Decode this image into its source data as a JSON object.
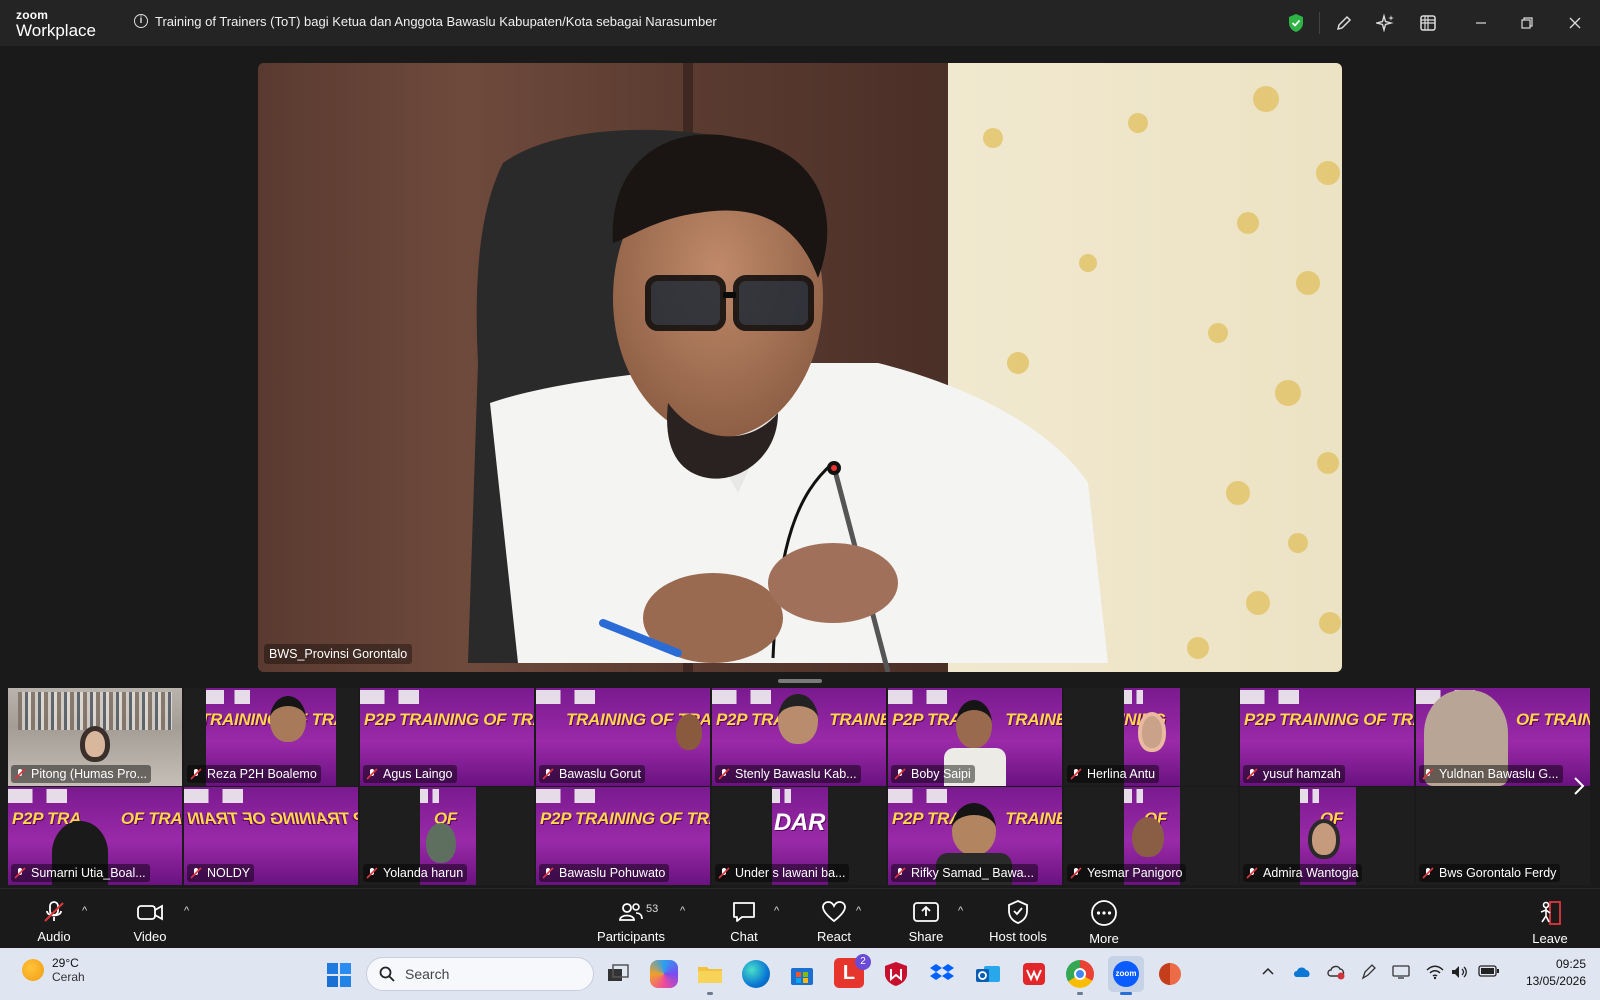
{
  "titlebar": {
    "brand_top": "zoom",
    "brand_bottom": "Workplace",
    "meeting_title": "Training of Trainers (ToT) bagi Ketua dan Anggota Bawaslu Kabupaten/Kota sebagai Narasumber",
    "icons": [
      "info-icon",
      "shield-check-icon",
      "pencil-icon",
      "ai-sparkle-icon",
      "apps-grid-icon",
      "minimize-icon",
      "restore-icon",
      "close-icon"
    ]
  },
  "main_video": {
    "speaker_name": "BWS_Provinsi Gorontalo"
  },
  "gallery": {
    "tiles": [
      {
        "name": "Pitong (Humas Pro...",
        "style": "room"
      },
      {
        "name": "Reza P2H Boalemo",
        "style": "banner-face"
      },
      {
        "name": "Agus Laingo",
        "style": "banner"
      },
      {
        "name": "Bawaslu Gorut",
        "style": "banner-face"
      },
      {
        "name": "Stenly Bawaslu Kab...",
        "style": "banner-face"
      },
      {
        "name": "Boby Saipi",
        "style": "banner-face"
      },
      {
        "name": "Herlina Antu",
        "style": "narrow"
      },
      {
        "name": "yusuf hamzah",
        "style": "banner"
      },
      {
        "name": "Yuldnan Bawaslu G...",
        "style": "banner-face"
      },
      {
        "name": "Sumarni Utia_Boal...",
        "style": "banner-face"
      },
      {
        "name": "NOLDY",
        "style": "banner-flip"
      },
      {
        "name": "Yolanda harun",
        "style": "narrow"
      },
      {
        "name": "Bawaslu Pohuwato",
        "style": "banner"
      },
      {
        "name": "Under s lawani ba...",
        "style": "narrow"
      },
      {
        "name": "Rifky Samad_ Bawa...",
        "style": "banner-face"
      },
      {
        "name": "Yesmar Panigoro",
        "style": "narrow"
      },
      {
        "name": "Admira Wantogia",
        "style": "narrow"
      },
      {
        "name": "Bws Gorontalo Ferdy",
        "style": "empty"
      }
    ],
    "banner_text": "P2P TRAINING OF TRAINER",
    "next_icon": "chevron-right-icon"
  },
  "toolbar": {
    "audio": "Audio",
    "video": "Video",
    "participants": "Participants",
    "participants_count": "53",
    "chat": "Chat",
    "react": "React",
    "share": "Share",
    "host_tools": "Host tools",
    "more": "More",
    "leave": "Leave"
  },
  "taskbar": {
    "temperature": "29°C",
    "weather": "Cerah",
    "search_placeholder": "Search",
    "time": "09:25",
    "date": "13/05/2026",
    "badge": "2"
  },
  "colors": {
    "zoom_green": "#2fb344",
    "banner_purple": "#8a1fa0",
    "banner_yellow": "#ffd84a",
    "muted_red": "#e0353d"
  }
}
